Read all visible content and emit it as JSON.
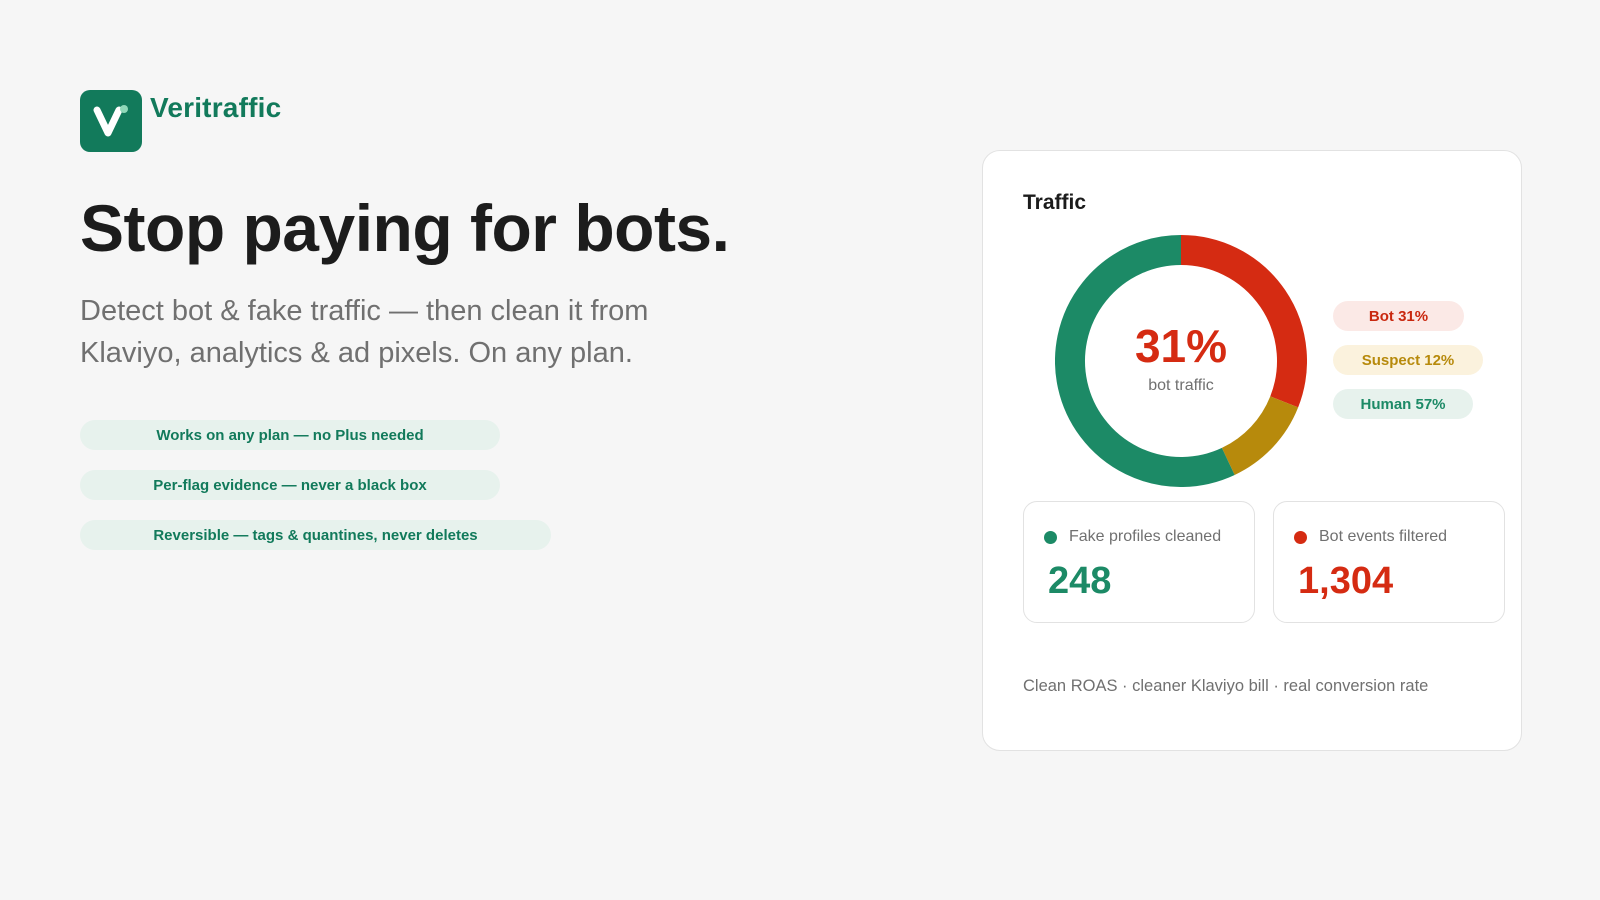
{
  "brand": {
    "name": "Veritraffic",
    "logo_icon": "checkmark-v-icon",
    "color": "#127a5b"
  },
  "hero": {
    "headline": "Stop paying for bots.",
    "subtitle": "Detect bot & fake traffic — then clean it from Klaviyo, analytics & ad pixels. On any plan."
  },
  "features": [
    "Works on any plan — no Plus needed",
    "Per-flag evidence — never a black box",
    "Reversible — tags & quantines, never deletes"
  ],
  "card": {
    "title": "Traffic",
    "center_value": "31%",
    "center_label": "bot traffic",
    "legend": {
      "bot": "Bot 31%",
      "suspect": "Suspect 12%",
      "human": "Human 57%"
    },
    "stats": [
      {
        "label": "Fake profiles cleaned",
        "value": "248"
      },
      {
        "label": "Bot events filtered",
        "value": "1,304"
      }
    ],
    "footer": "Clean ROAS · cleaner Klaviyo bill · real conversion rate"
  },
  "chart_data": {
    "type": "pie",
    "categories": [
      "Bot",
      "Suspect",
      "Human"
    ],
    "values": [
      31,
      12,
      57
    ],
    "colors": [
      "#d52b12",
      "#b78a0c",
      "#1c8a66"
    ],
    "title": "Traffic"
  }
}
